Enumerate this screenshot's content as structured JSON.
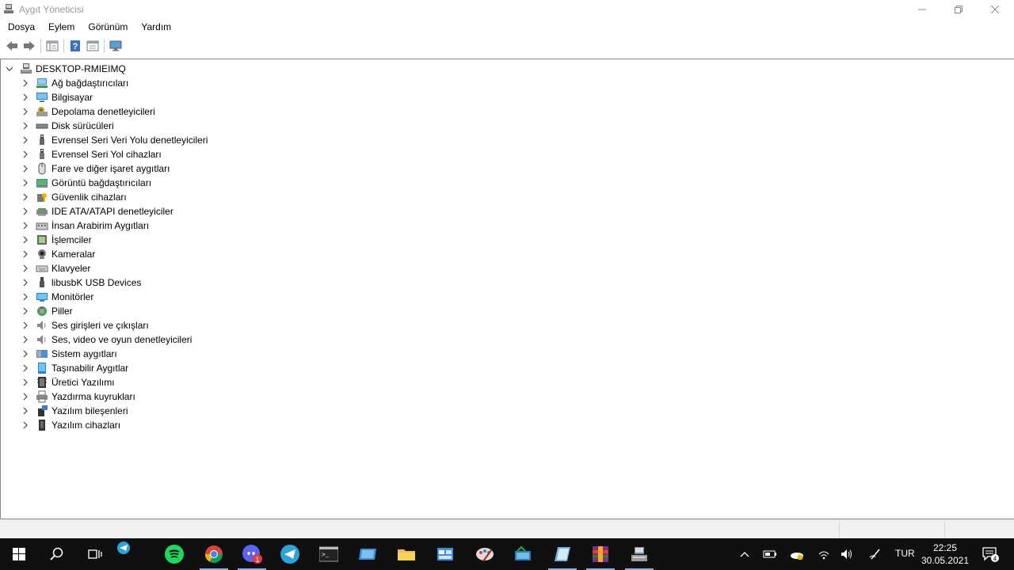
{
  "window": {
    "title": "Aygıt Yöneticisi"
  },
  "menu": [
    "Dosya",
    "Eylem",
    "Görünüm",
    "Yardım"
  ],
  "toolbar": {
    "buttons": [
      "back-icon",
      "forward-icon",
      "properties-icon",
      "help-icon",
      "update-driver-icon",
      "monitor-scan-icon"
    ]
  },
  "tree": {
    "root": "DESKTOP-RMIEIMQ",
    "items": [
      {
        "label": "Ağ bağdaştırıcıları",
        "icon": "network-adapter-icon"
      },
      {
        "label": "Bilgisayar",
        "icon": "computer-icon"
      },
      {
        "label": "Depolama denetleyicileri",
        "icon": "storage-controller-icon"
      },
      {
        "label": "Disk sürücüleri",
        "icon": "disk-drive-icon"
      },
      {
        "label": "Evrensel Seri Veri Yolu denetleyicileri",
        "icon": "usb-icon"
      },
      {
        "label": "Evrensel Seri Yol cihazları",
        "icon": "usb-device-icon"
      },
      {
        "label": "Fare ve diğer işaret aygıtları",
        "icon": "mouse-icon"
      },
      {
        "label": "Görüntü bağdaştırıcıları",
        "icon": "display-adapter-icon"
      },
      {
        "label": "Güvenlik cihazları",
        "icon": "security-device-icon"
      },
      {
        "label": "IDE ATA/ATAPI denetleyiciler",
        "icon": "ide-controller-icon"
      },
      {
        "label": "İnsan Arabirim Aygıtları",
        "icon": "hid-icon"
      },
      {
        "label": "İşlemciler",
        "icon": "processor-icon"
      },
      {
        "label": "Kameralar",
        "icon": "camera-icon"
      },
      {
        "label": "Klavyeler",
        "icon": "keyboard-icon"
      },
      {
        "label": "libusbK USB Devices",
        "icon": "libusb-icon"
      },
      {
        "label": "Monitörler",
        "icon": "monitor-icon"
      },
      {
        "label": "Piller",
        "icon": "battery-icon"
      },
      {
        "label": "Ses girişleri ve çıkışları",
        "icon": "audio-io-icon"
      },
      {
        "label": "Ses, video ve oyun denetleyicileri",
        "icon": "sound-video-icon"
      },
      {
        "label": "Sistem aygıtları",
        "icon": "system-device-icon"
      },
      {
        "label": "Taşınabilir Aygıtlar",
        "icon": "portable-device-icon"
      },
      {
        "label": "Üretici Yazılımı",
        "icon": "firmware-icon"
      },
      {
        "label": "Yazdırma kuyrukları",
        "icon": "print-queue-icon"
      },
      {
        "label": "Yazılım bileşenleri",
        "icon": "software-component-icon"
      },
      {
        "label": "Yazılım cihazları",
        "icon": "software-device-icon"
      }
    ]
  },
  "taskbar": {
    "apps": [
      "start-icon",
      "search-icon",
      "task-view-icon",
      "telegram-notify-icon",
      "spotify-icon",
      "chrome-icon",
      "discord-icon",
      "telegram-icon",
      "terminal-icon",
      "tablet-app-icon",
      "file-explorer-icon",
      "control-panel-icon",
      "paint-icon",
      "store-app-icon",
      "notes-icon",
      "winrar-icon",
      "device-manager-icon"
    ],
    "discord_badge": "1",
    "notification_count": "4",
    "language": "TUR",
    "time": "22:25",
    "date": "30.05.2021"
  },
  "colors": {
    "taskbar_bg": "#101010",
    "accent": "#0078d7"
  }
}
